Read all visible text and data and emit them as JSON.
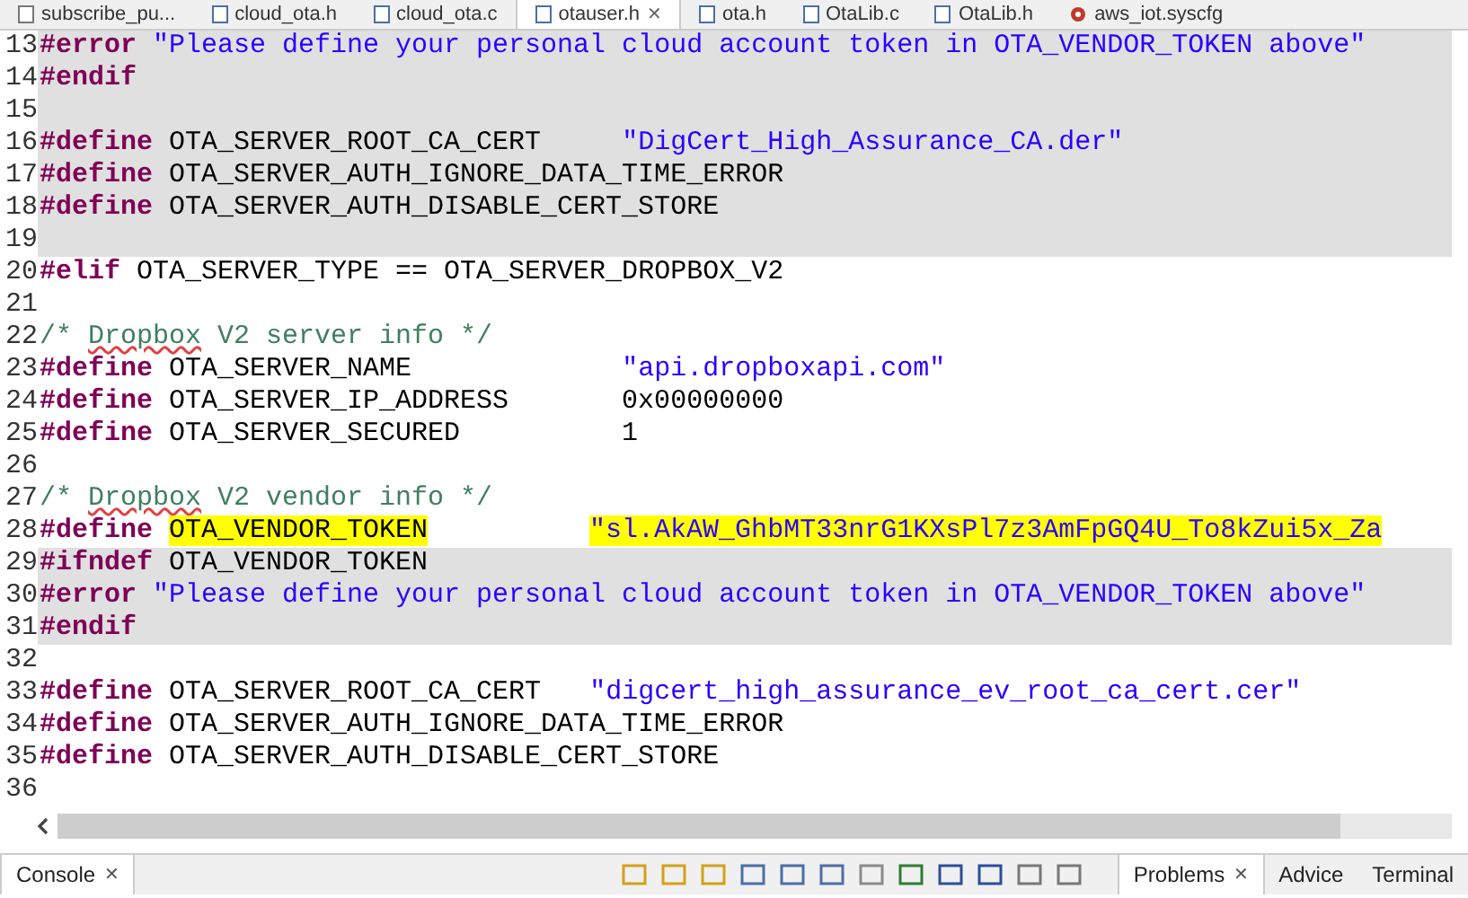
{
  "editor_tabs": [
    {
      "label": "subscribe_pu...",
      "selected": false,
      "kind": "text"
    },
    {
      "label": "cloud_ota.h",
      "selected": false,
      "kind": "header"
    },
    {
      "label": "cloud_ota.c",
      "selected": false,
      "kind": "source"
    },
    {
      "label": "otauser.h",
      "selected": true,
      "kind": "header",
      "close": "✕"
    },
    {
      "label": "ota.h",
      "selected": false,
      "kind": "header"
    },
    {
      "label": "OtaLib.c",
      "selected": false,
      "kind": "source"
    },
    {
      "label": "OtaLib.h",
      "selected": false,
      "kind": "header"
    },
    {
      "label": "aws_iot.syscfg",
      "selected": false,
      "kind": "config"
    }
  ],
  "code_lines": [
    {
      "number": "13",
      "inactive": true,
      "segments": [
        {
          "kind": "keyword",
          "text": "#error"
        },
        {
          "kind": "string",
          "text": " \"Please define your personal cloud account token in OTA_VENDOR_TOKEN above\""
        }
      ]
    },
    {
      "number": "14",
      "inactive": true,
      "segments": [
        {
          "kind": "keyword",
          "text": "#endif"
        }
      ]
    },
    {
      "number": "15",
      "inactive": true
    },
    {
      "number": "16",
      "inactive": true,
      "segments": [
        {
          "kind": "keyword",
          "text": "#define"
        },
        {
          "kind": "plain",
          "text": " OTA_SERVER_ROOT_CA_CERT     "
        },
        {
          "kind": "string",
          "text": "\"DigCert_High_Assurance_CA.der\""
        }
      ]
    },
    {
      "number": "17",
      "inactive": true,
      "segments": [
        {
          "kind": "keyword",
          "text": "#define"
        },
        {
          "kind": "plain",
          "text": " OTA_SERVER_AUTH_IGNORE_DATA_TIME_ERROR"
        }
      ]
    },
    {
      "number": "18",
      "inactive": true,
      "segments": [
        {
          "kind": "keyword",
          "text": "#define"
        },
        {
          "kind": "plain",
          "text": " OTA_SERVER_AUTH_DISABLE_CERT_STORE"
        }
      ]
    },
    {
      "number": "19",
      "inactive": true
    },
    {
      "number": "20",
      "inactive": false,
      "segments": [
        {
          "kind": "keyword",
          "text": "#elif"
        },
        {
          "kind": "plain",
          "text": " OTA_SERVER_TYPE == OTA_SERVER_DROPBOX_V2"
        }
      ]
    },
    {
      "number": "21",
      "inactive": false
    },
    {
      "number": "22",
      "inactive": false,
      "segments": [
        {
          "kind": "comment",
          "text": "/* "
        },
        {
          "kind": "misspelled",
          "text": "Dropbox"
        },
        {
          "kind": "comment",
          "text": " V2 server info */"
        }
      ]
    },
    {
      "number": "23",
      "inactive": false,
      "segments": [
        {
          "kind": "keyword",
          "text": "#define"
        },
        {
          "kind": "plain",
          "text": " OTA_SERVER_NAME             "
        },
        {
          "kind": "string",
          "text": "\"api.dropboxapi.com\""
        }
      ]
    },
    {
      "number": "24",
      "inactive": false,
      "segments": [
        {
          "kind": "keyword",
          "text": "#define"
        },
        {
          "kind": "plain",
          "text": " OTA_SERVER_IP_ADDRESS       0x00000000"
        }
      ]
    },
    {
      "number": "25",
      "inactive": false,
      "segments": [
        {
          "kind": "keyword",
          "text": "#define"
        },
        {
          "kind": "plain",
          "text": " OTA_SERVER_SECURED          1"
        }
      ]
    },
    {
      "number": "26",
      "inactive": false
    },
    {
      "number": "27",
      "inactive": false,
      "segments": [
        {
          "kind": "comment",
          "text": "/* "
        },
        {
          "kind": "misspelled",
          "text": "Dropbox"
        },
        {
          "kind": "comment",
          "text": " V2 vendor info */"
        }
      ]
    },
    {
      "number": "28",
      "inactive": false,
      "segments": [
        {
          "kind": "keyword",
          "text": "#define"
        },
        {
          "kind": "highlight",
          "text": "OTA_VENDOR_TOKEN"
        },
        {
          "kind": "highlight-string",
          "text": "\"sl.AkAW_GhbMT33nrG1KXsPl7z3AmFpGQ4U_To8kZui5x_Za"
        }
      ]
    },
    {
      "number": "29",
      "inactive": true,
      "segments": [
        {
          "kind": "keyword",
          "text": "#ifndef"
        },
        {
          "kind": "plain",
          "text": " OTA_VENDOR_TOKEN"
        }
      ]
    },
    {
      "number": "30",
      "inactive": true,
      "segments": [
        {
          "kind": "keyword",
          "text": "#error"
        },
        {
          "kind": "string",
          "text": " \"Please define your personal cloud account token in OTA_VENDOR_TOKEN above\""
        }
      ]
    },
    {
      "number": "31",
      "inactive": true,
      "segments": [
        {
          "kind": "keyword",
          "text": "#endif"
        }
      ]
    },
    {
      "number": "32",
      "inactive": false
    },
    {
      "number": "33",
      "inactive": false,
      "segments": [
        {
          "kind": "keyword",
          "text": "#define"
        },
        {
          "kind": "plain",
          "text": " OTA_SERVER_ROOT_CA_CERT   "
        },
        {
          "kind": "string",
          "text": "\"digcert_high_assurance_ev_root_ca_cert.cer\""
        }
      ]
    },
    {
      "number": "34",
      "inactive": false,
      "segments": [
        {
          "kind": "keyword",
          "text": "#define"
        },
        {
          "kind": "plain",
          "text": " OTA_SERVER_AUTH_IGNORE_DATA_TIME_ERROR"
        }
      ]
    },
    {
      "number": "35",
      "inactive": false,
      "segments": [
        {
          "kind": "keyword",
          "text": "#define"
        },
        {
          "kind": "plain",
          "text": " OTA_SERVER_AUTH_DISABLE_CERT_STORE"
        }
      ]
    },
    {
      "number": "36",
      "inactive": false
    }
  ],
  "bottom_tabs": [
    {
      "label": "Console",
      "selected": true,
      "close": "✕"
    },
    {
      "label": "Problems",
      "selected": true,
      "close": "✕"
    },
    {
      "label": "Advice",
      "selected": false
    },
    {
      "label": "Terminal",
      "selected": false
    }
  ]
}
